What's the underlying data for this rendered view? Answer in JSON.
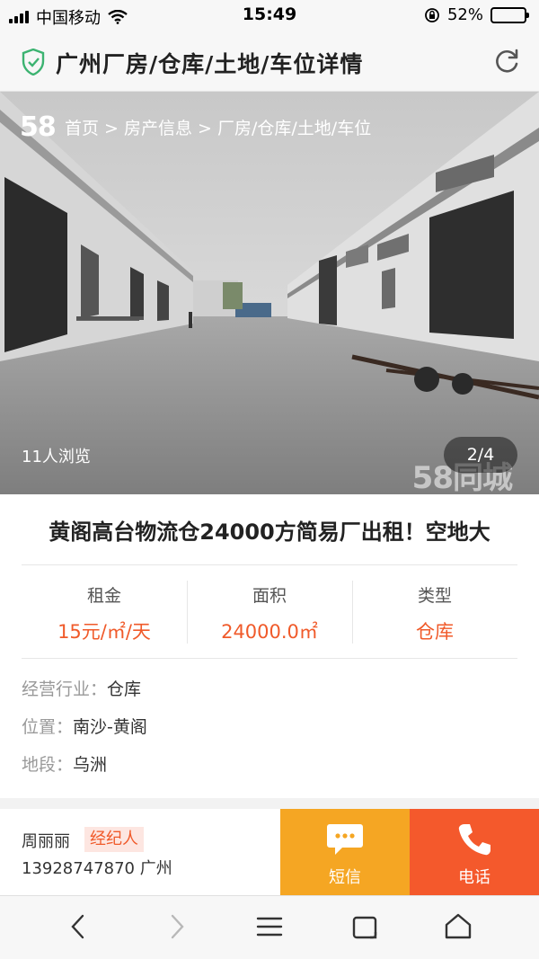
{
  "status_bar": {
    "carrier": "中国移动",
    "time": "15:49",
    "battery_percent": "52%",
    "battery_level": 0.52
  },
  "header": {
    "title": "广州厂房/仓库/土地/车位详情",
    "shield_icon": "shield-check-icon",
    "refresh_icon": "refresh-icon"
  },
  "hero": {
    "logo": "58",
    "breadcrumb": "首页 > 房产信息 > 厂房/仓库/土地/车位",
    "views": "11人浏览",
    "pager": "2/4",
    "watermark": "58同城"
  },
  "listing": {
    "title": "黄阁高台物流仓24000方简易厂出租！空地大",
    "stats": [
      {
        "label": "租金",
        "value": "15元/㎡/天"
      },
      {
        "label": "面积",
        "value": "24000.0㎡"
      },
      {
        "label": "类型",
        "value": "仓库"
      }
    ],
    "details": [
      {
        "key": "经营行业：",
        "value": "仓库"
      },
      {
        "key": "位置：",
        "value": "南沙-黄阁"
      },
      {
        "key": "地段：",
        "value": "乌洲"
      }
    ]
  },
  "contact": {
    "agent_name": "周丽丽",
    "agent_badge": "经纪人",
    "phone_city": "13928747870  广州",
    "sms_label": "短信",
    "call_label": "电话"
  },
  "colors": {
    "accent": "#f05a2a",
    "sms_bg": "#f5a623",
    "call_bg": "#f4592c",
    "shield": "#3cb371"
  }
}
